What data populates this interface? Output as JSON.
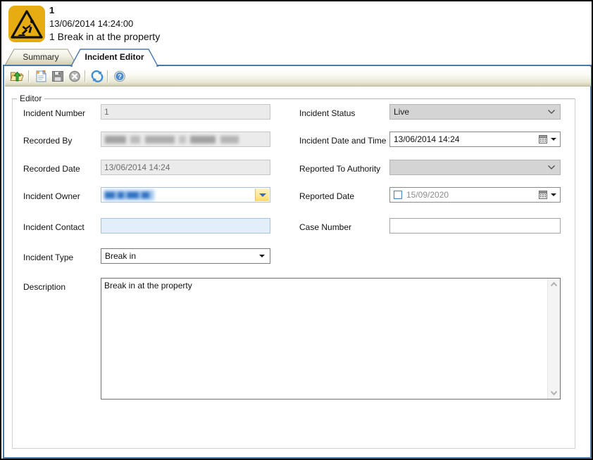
{
  "window": {
    "accent_blue": "#4a78a8",
    "toolbar_gradient_end": "#cfcdb0"
  },
  "header": {
    "icon_name": "hazard-warning-icon",
    "icon_color": "#e8ac13",
    "number": "1",
    "datetime": "13/06/2014 14:24:00",
    "title": "1 Break in at the property"
  },
  "tabs": [
    {
      "id": "summary",
      "label": "Summary",
      "active": false
    },
    {
      "id": "incident-editor",
      "label": "Incident Editor",
      "active": true
    }
  ],
  "toolbar": {
    "buttons": [
      {
        "name": "open-incident-button",
        "icon": "open-folder-green-arrow-icon",
        "title": "Open"
      },
      {
        "name": "new-incident-button",
        "icon": "new-document-icon",
        "title": "New"
      },
      {
        "name": "save-button",
        "icon": "floppy-disk-icon",
        "title": "Save"
      },
      {
        "name": "cancel-button",
        "icon": "cancel-circle-icon",
        "title": "Cancel"
      },
      {
        "name": "refresh-button",
        "icon": "refresh-arrows-icon",
        "title": "Refresh"
      },
      {
        "name": "help-button",
        "icon": "help-question-icon",
        "title": "Help"
      }
    ]
  },
  "group": {
    "legend": "Editor"
  },
  "form": {
    "left": [
      {
        "name": "incident-number",
        "label": "Incident Number",
        "control": "textbox",
        "value": "1",
        "readonly": true,
        "placeholder": ""
      },
      {
        "name": "recorded-by",
        "label": "Recorded By",
        "control": "textbox-redacted",
        "value": "",
        "readonly": true,
        "placeholder": ""
      },
      {
        "name": "recorded-date",
        "label": "Recorded Date",
        "control": "textbox",
        "value": "13/06/2014 14:24",
        "readonly": true,
        "placeholder": ""
      },
      {
        "name": "incident-owner",
        "label": "Incident Owner",
        "control": "combobox-amber-redacted",
        "value": "",
        "readonly": false,
        "placeholder": ""
      },
      {
        "name": "incident-contact",
        "label": "Incident Contact",
        "control": "textbox-highlight",
        "value": "",
        "readonly": false,
        "placeholder": ""
      },
      {
        "name": "incident-type",
        "label": "Incident Type",
        "control": "combobox-classic",
        "value": "Break in",
        "readonly": false,
        "placeholder": ""
      }
    ],
    "right": [
      {
        "name": "incident-status",
        "label": "Incident Status",
        "control": "combobox-disabled",
        "value": "Live",
        "readonly": true,
        "placeholder": ""
      },
      {
        "name": "incident-date-and-time",
        "label": "Incident Date and Time",
        "control": "datepicker",
        "value": "13/06/2014 14:24",
        "readonly": false,
        "placeholder": ""
      },
      {
        "name": "reported-to-authority",
        "label": "Reported To Authority",
        "control": "combobox-disabled",
        "value": "",
        "readonly": true,
        "placeholder": ""
      },
      {
        "name": "reported-date",
        "label": "Reported Date",
        "control": "datepicker-checkbox",
        "value": "15/09/2020",
        "checked": false,
        "readonly": false,
        "placeholder": ""
      },
      {
        "name": "case-number",
        "label": "Case Number",
        "control": "textbox",
        "value": "",
        "readonly": false,
        "placeholder": ""
      }
    ],
    "description": {
      "label": "Description",
      "value": "Break in at the property",
      "placeholder": ""
    }
  }
}
